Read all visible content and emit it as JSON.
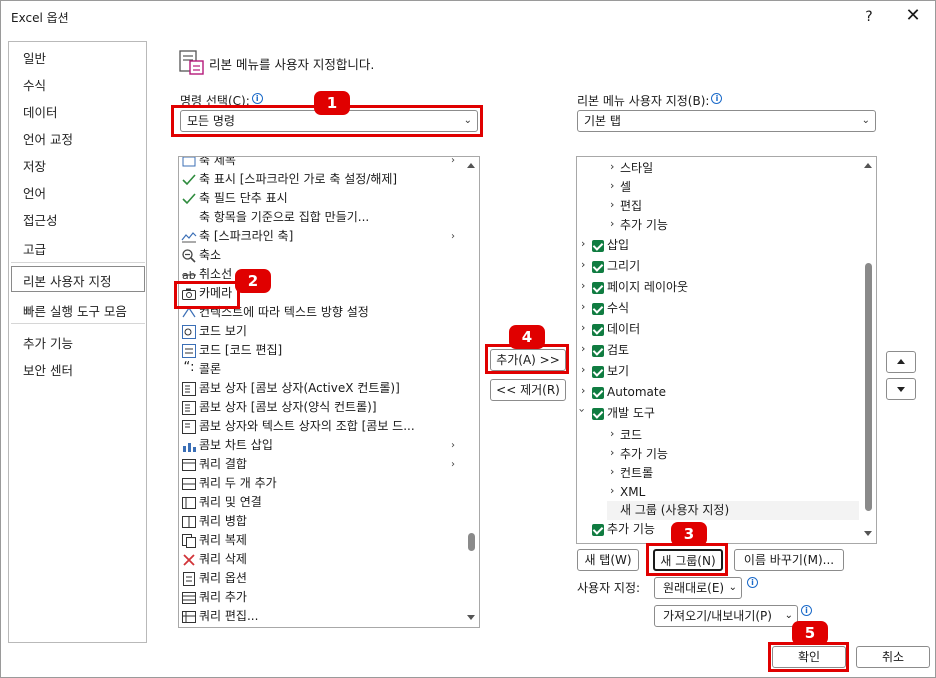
{
  "window": {
    "title": "Excel 옵션",
    "help": "?",
    "close": "✕"
  },
  "nav": {
    "items": [
      "일반",
      "수식",
      "데이터",
      "언어 교정",
      "저장",
      "언어",
      "접근성",
      "고급",
      "리본 사용자 지정",
      "빠른 실행 도구 모음",
      "추가 기능",
      "보안 센터"
    ],
    "selected_index": 8
  },
  "header": {
    "text": "리본 메뉴를 사용자 지정합니다."
  },
  "left": {
    "label": "명령 선택(C):",
    "combo_value": "모든 명령",
    "items": [
      "축 제목",
      "축 표시 [스파크라인 가로 축 설정/해제]",
      "축 필드 단추 표시",
      "축 항목을 기준으로 집합 만들기...",
      "축 [스파크라인 축]",
      "축소",
      "취소선",
      "카메라",
      "컨텍스트에 따라 텍스트 방향 설정",
      "코드 보기",
      "코드 [코드 편집]",
      "콜론",
      "콤보 상자 [콤보 상자(ActiveX 컨트롤)]",
      "콤보 상자 [콤보 상자(양식 컨트롤)]",
      "콤보 상자와 텍스트 상자의 조합 [콤보 드...",
      "콤보 차트 삽입",
      "쿼리 결합",
      "쿼리 두 개 추가",
      "쿼리 및 연결",
      "쿼리 병합",
      "쿼리 복제",
      "쿼리 삭제",
      "쿼리 옵션",
      "쿼리 추가",
      "쿼리 편집..."
    ]
  },
  "middle": {
    "add": "추가(A) >>",
    "remove": "<< 제거(R)"
  },
  "right": {
    "label": "리본 메뉴 사용자 지정(B):",
    "combo_value": "기본 탭",
    "tree": [
      "스타일",
      "셀",
      "편집",
      "추가 기능",
      "삽입",
      "그리기",
      "페이지 레이아웃",
      "수식",
      "데이터",
      "검토",
      "보기",
      "Automate",
      "개발 도구",
      "코드",
      "추가 기능",
      "컨트롤",
      "XML",
      "새 그룹 (사용자 지정)",
      "추가 기능"
    ],
    "new_tab": "새 탭(W)",
    "new_group": "새 그룹(N)",
    "rename": "이름 바꾸기(M)...",
    "customize_label": "사용자 지정:",
    "reset": "원래대로(E)",
    "import_export": "가져오기/내보내기(P)"
  },
  "footer": {
    "ok": "확인",
    "cancel": "취소"
  },
  "badges": {
    "b1": "1",
    "b2": "2",
    "b3": "3",
    "b4": "4",
    "b5": "5"
  },
  "colors": {
    "highlight": "#e00000",
    "check": "#107c41",
    "info": "#1b6ac9"
  }
}
